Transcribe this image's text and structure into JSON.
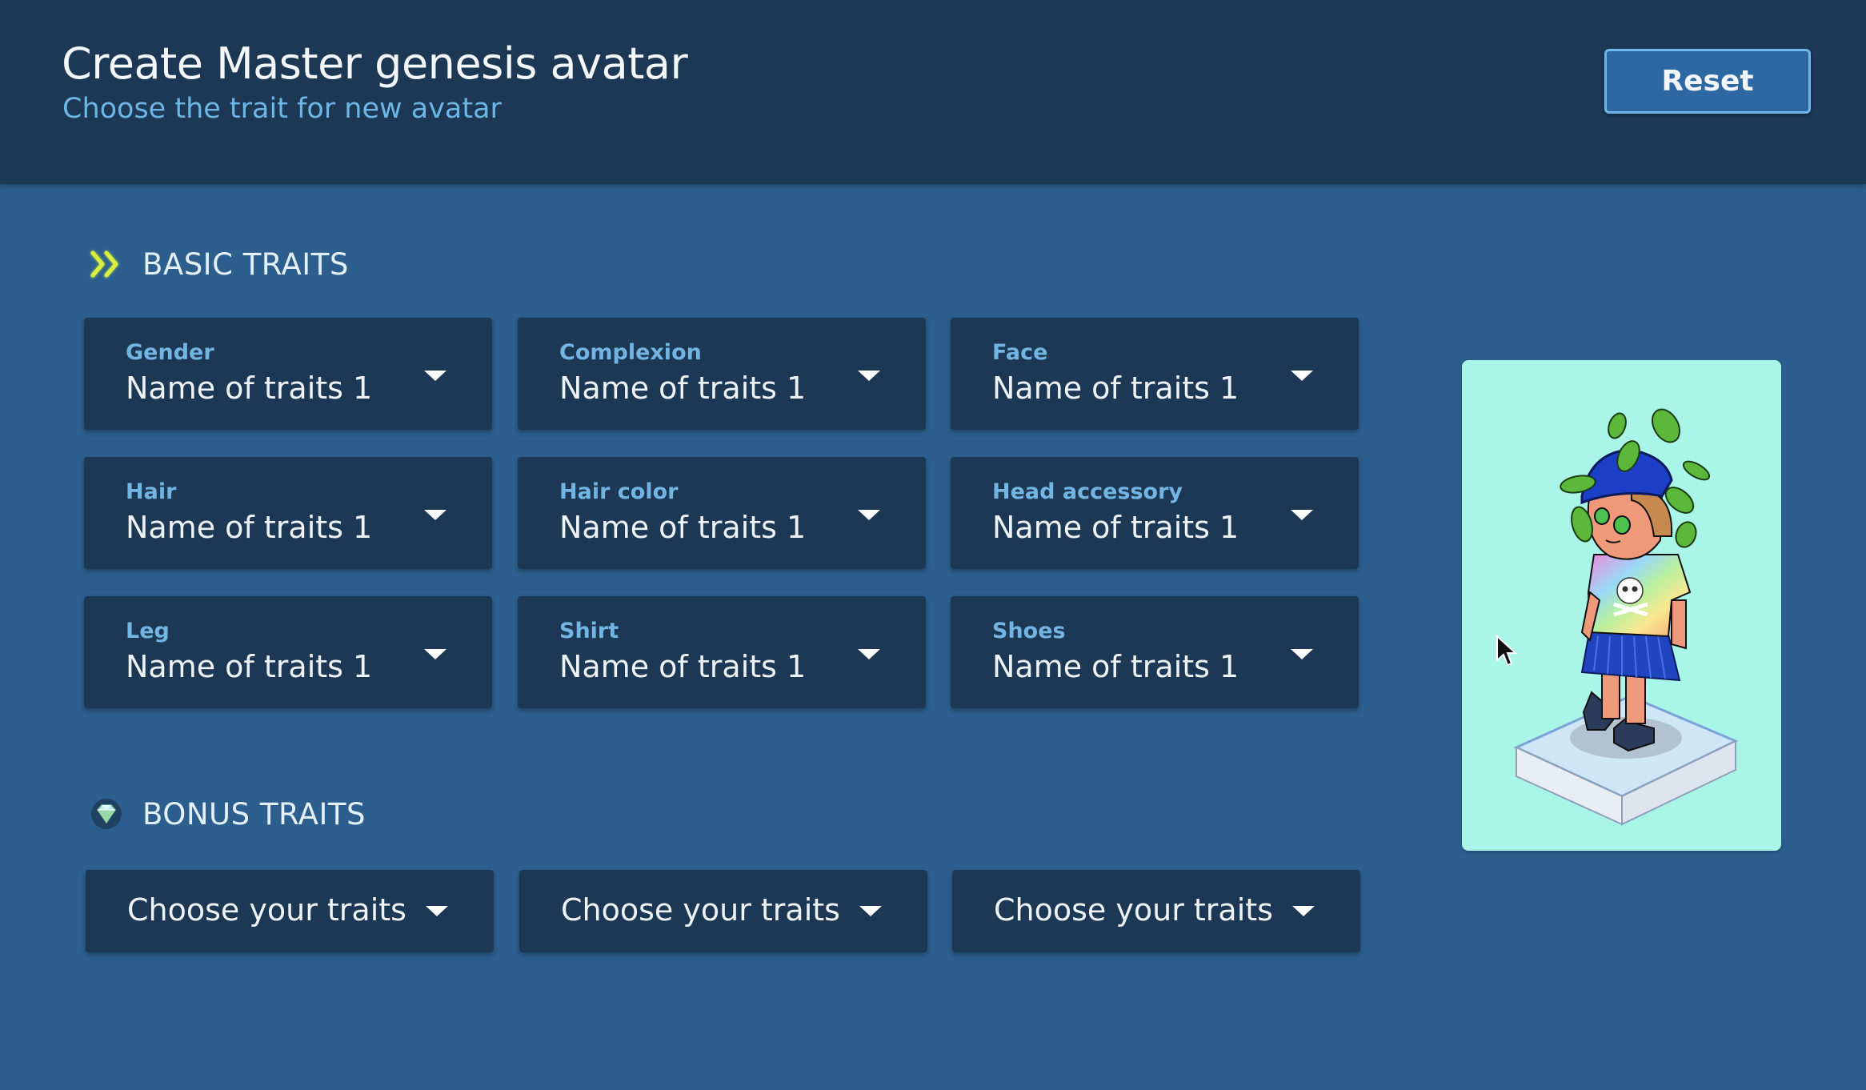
{
  "header": {
    "title": "Create Master genesis avatar",
    "subtitle": "Choose the trait for new avatar",
    "reset_label": "Reset"
  },
  "basic_traits": {
    "heading": "BASIC TRAITS",
    "icon": "double-chevron-right-icon",
    "icon_color": "#d8f03c",
    "fields": [
      {
        "label": "Gender",
        "value": "Name of traits 1"
      },
      {
        "label": "Complexion",
        "value": "Name of traits 1"
      },
      {
        "label": "Face",
        "value": "Name of traits 1"
      },
      {
        "label": "Hair",
        "value": "Name of traits 1"
      },
      {
        "label": "Hair color",
        "value": "Name of traits 1"
      },
      {
        "label": "Head accessory",
        "value": "Name of traits 1"
      },
      {
        "label": "Leg",
        "value": "Name of traits 1"
      },
      {
        "label": "Shirt",
        "value": "Name of traits 1"
      },
      {
        "label": "Shoes",
        "value": "Name of traits 1"
      }
    ]
  },
  "bonus_traits": {
    "heading": "BONUS TRAITS",
    "icon": "diamond-gem-icon",
    "fields": [
      {
        "value": "Choose your traits"
      },
      {
        "value": "Choose your traits"
      },
      {
        "value": "Choose your traits"
      }
    ]
  },
  "preview": {
    "description": "avatar-preview",
    "background": "#a9f5e7"
  },
  "colors": {
    "header_bg": "#1c3855",
    "page_bg": "#2c5f8e",
    "field_bg": "#1c3854",
    "label_color": "#72b4e2",
    "accent": "#73b6ea"
  }
}
